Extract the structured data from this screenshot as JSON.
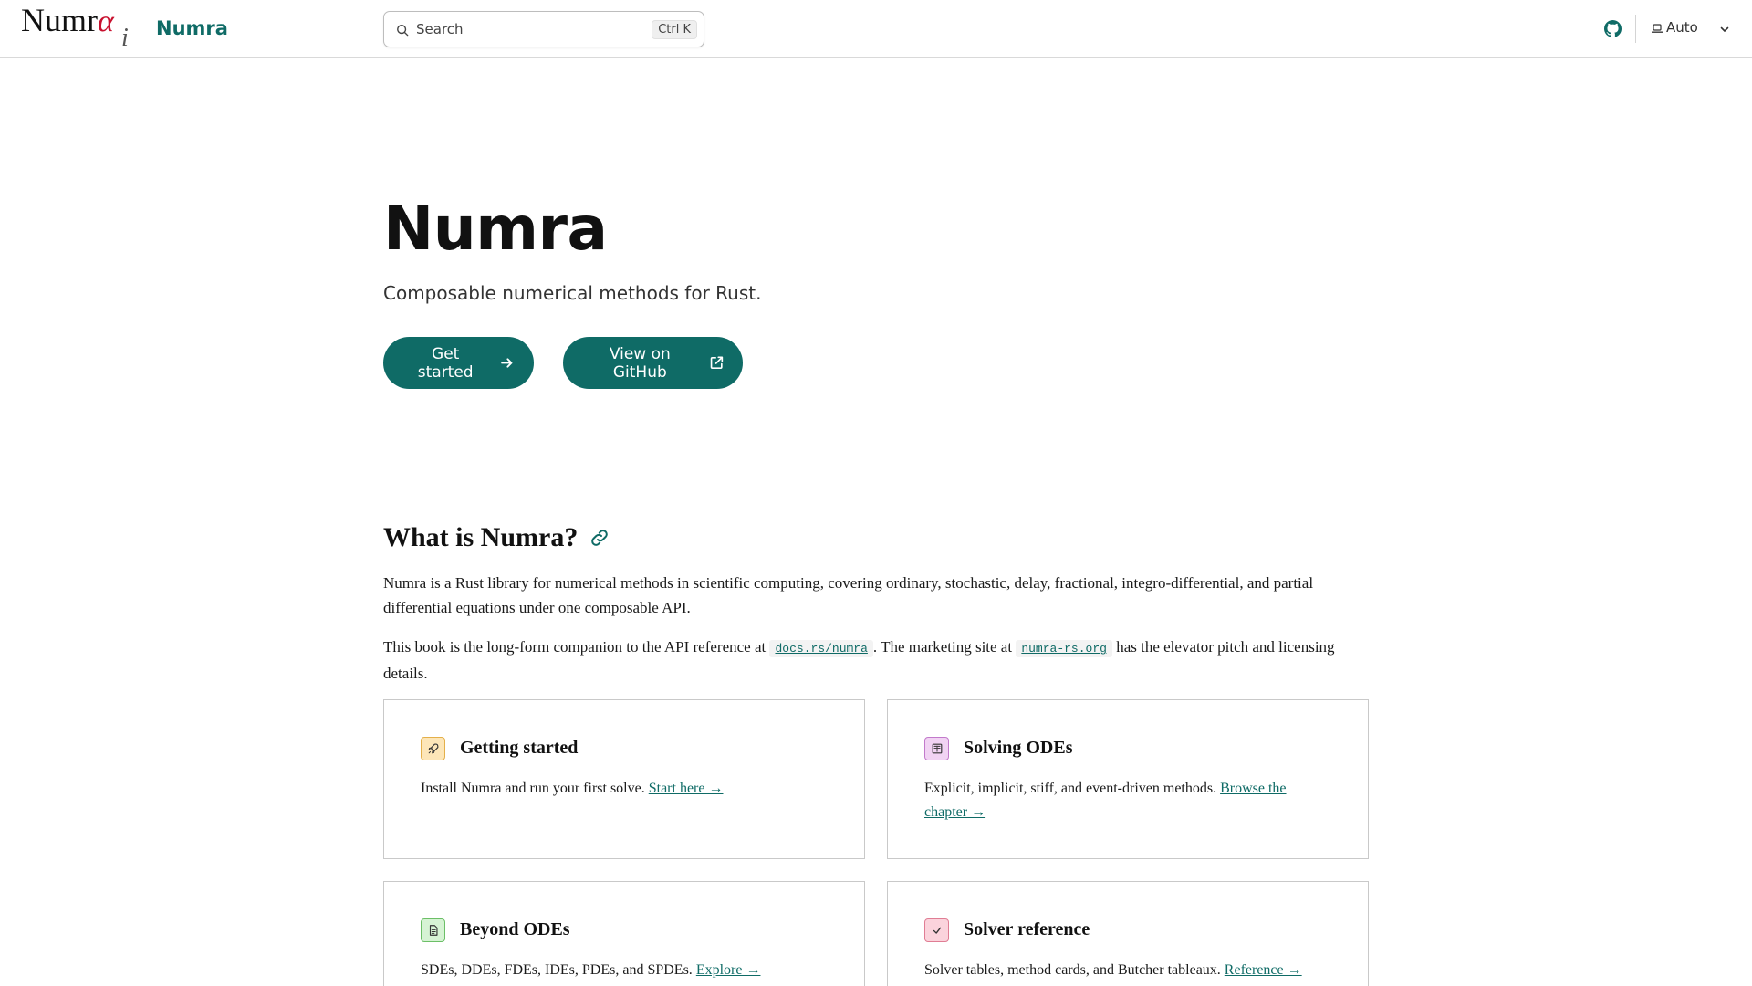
{
  "header": {
    "logo_main": "Numr",
    "logo_alpha": "α",
    "logo_i": "i",
    "brand": "Numra",
    "search_label": "Search",
    "search_shortcut": "Ctrl K",
    "theme_label": "Auto"
  },
  "hero": {
    "title": "Numra",
    "subtitle": "Composable numerical methods for Rust.",
    "primary_button": "Get started",
    "secondary_button": "View on GitHub"
  },
  "intro": {
    "heading": "What is Numra?",
    "paragraph1": "Numra is a Rust library for numerical methods in scientific computing, covering ordinary, stochastic, delay, fractional, integro-differential, and partial differential equations under one composable API.",
    "p2_part1": "This book is the long-form companion to the API reference at ",
    "p2_code1": "docs.rs/numra",
    "p2_part2": ". The marketing site at ",
    "p2_code2": "numra-rs.org",
    "p2_part3": " has the elevator pitch and licensing details."
  },
  "cards": [
    {
      "title": "Getting started",
      "text": "Install Numra and run your first solve. ",
      "link": "Start here →"
    },
    {
      "title": "Solving ODEs",
      "text": "Explicit, implicit, stiff, and event-driven methods. ",
      "link": "Browse the chapter →"
    },
    {
      "title": "Beyond ODEs",
      "text": "SDEs, DDEs, FDEs, IDEs, PDEs, and SPDEs. ",
      "link": "Explore →"
    },
    {
      "title": "Solver reference",
      "text": "Solver tables, method cards, and Butcher tableaux. ",
      "link": "Reference →"
    }
  ],
  "colors": {
    "accent": "#0f6b66",
    "logo_alpha": "#c8102e"
  },
  "icons": {
    "search": "search-icon",
    "github": "github-icon",
    "theme": "laptop-icon",
    "chevron": "chevron-down-icon",
    "arrow": "arrow-right-icon",
    "external": "external-link-icon",
    "anchor": "link-icon",
    "card_icons": [
      "rocket-icon",
      "book-icon",
      "document-icon",
      "check-icon"
    ]
  }
}
